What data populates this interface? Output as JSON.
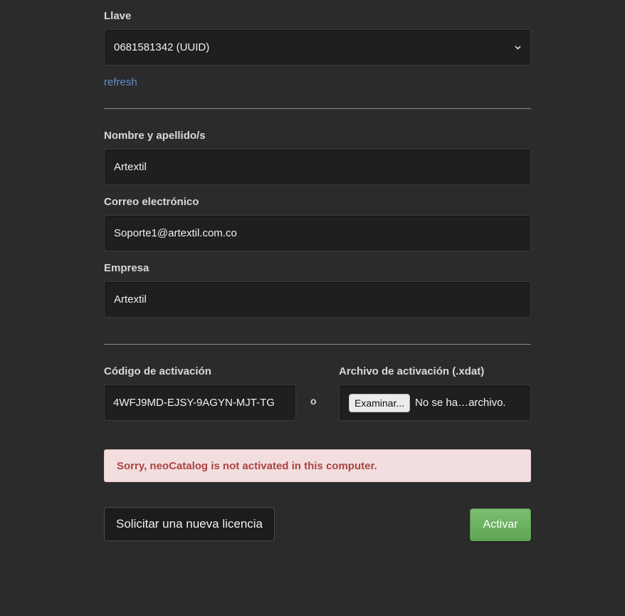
{
  "license": {
    "key_label": "Llave",
    "key_value": "0681581342 (UUID)",
    "refresh_label": "refresh"
  },
  "user": {
    "name_label": "Nombre y apellido/s",
    "name_value": "Artextil",
    "email_label": "Correo electrónico",
    "email_value": "Soporte1@artextil.com.co",
    "company_label": "Empresa",
    "company_value": "Artextil"
  },
  "activation": {
    "code_label": "Código de activación",
    "code_value": "4WFJ9MD-EJSY-9AGYN-MJT-TG",
    "or_text": "o",
    "file_label": "Archivo de activación (.xdat)",
    "browse_label": "Examinar...",
    "file_status": "No se ha…archivo."
  },
  "alert": {
    "message": "Sorry, neoCatalog is not activated in this computer."
  },
  "buttons": {
    "request_license": "Solicitar una nueva licencia",
    "activate": "Activar"
  },
  "colors": {
    "background": "#2b2b2b",
    "link": "#5d8fc7",
    "alert_bg": "#f2dede",
    "alert_text": "#a94442",
    "success": "#5ea553"
  }
}
